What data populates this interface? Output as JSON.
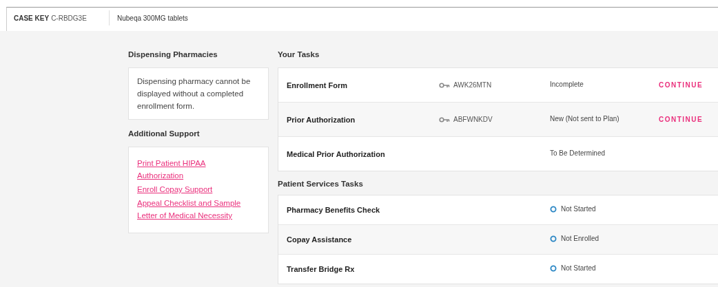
{
  "header": {
    "case_key_label": "CASE KEY",
    "case_key": "C-RBDG3E",
    "product": "Nubeqa 300MG tablets"
  },
  "dispensing_pharmacies": {
    "title": "Dispensing Pharmacies",
    "message": "Dispensing pharmacy cannot be displayed without a completed enrollment form."
  },
  "additional_support": {
    "title": "Additional Support",
    "links": [
      "Print Patient HIPAA Authorization",
      "Enroll Copay Support",
      "Appeal Checklist and Sample Letter of Medical Necessity"
    ]
  },
  "your_tasks": {
    "title": "Your Tasks",
    "rows": [
      {
        "name": "Enrollment Form",
        "key": "AWK26MTN",
        "status": "Incomplete",
        "action": "CONTINUE"
      },
      {
        "name": "Prior Authorization",
        "key": "ABFWNKDV",
        "status": "New (Not sent to Plan)",
        "action": "CONTINUE"
      },
      {
        "name": "Medical Prior Authorization",
        "status": "To Be Determined"
      }
    ]
  },
  "patient_services_tasks": {
    "title": "Patient Services Tasks",
    "rows": [
      {
        "name": "Pharmacy Benefits Check",
        "status": "Not Started"
      },
      {
        "name": "Copay Assistance",
        "status": "Not Enrolled"
      },
      {
        "name": "Transfer Bridge Rx",
        "status": "Not Started"
      }
    ]
  }
}
